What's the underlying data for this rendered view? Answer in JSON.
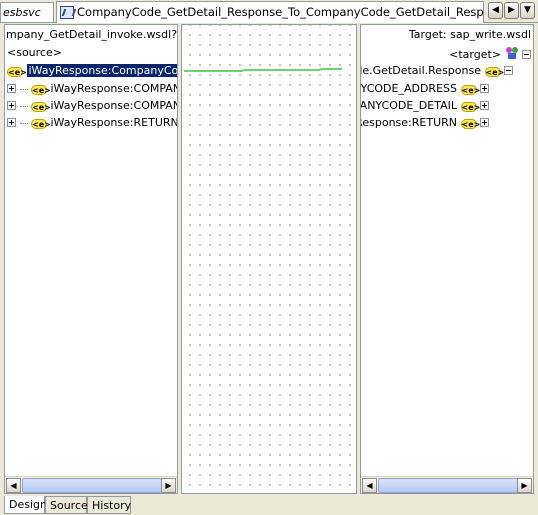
{
  "tabs": {
    "left_tab": "esbsvc",
    "active_tab": "CompanyCode_GetDetail_Response_To_CompanyCode_GetDetail_Response.xsl"
  },
  "nav_buttons": {
    "back": "◀",
    "forward": "▶",
    "menu": "▼"
  },
  "source_panel": {
    "header": "mpany_GetDetail_invoke.wsdl?wsdl",
    "root": "<source>",
    "nodes": [
      {
        "label": "iWayResponse:CompanyCode.G",
        "expanded": true,
        "selected": true
      },
      {
        "label": "iWayResponse:COMPANYC",
        "expanded": false
      },
      {
        "label": "iWayResponse:COMPANYC",
        "expanded": false
      },
      {
        "label": "iWayResponse:RETURN",
        "expanded": false
      }
    ]
  },
  "target_panel": {
    "header": "Target: sap_write.wsdl",
    "root": "<target>",
    "nodes": [
      {
        "label": "de.GetDetail.Response",
        "expanded": true
      },
      {
        "label": "NYCODE_ADDRESS",
        "expanded": false
      },
      {
        "label": "'ANYCODE_DETAIL",
        "expanded": false
      },
      {
        "label": "Response:RETURN",
        "expanded": false
      }
    ]
  },
  "element_icon_text": "<e>",
  "mapping_line_color": "#6dd16d",
  "scroll": {
    "left": "◀",
    "right": "▶"
  },
  "bottom_tabs": [
    "Design",
    "Source",
    "History"
  ]
}
